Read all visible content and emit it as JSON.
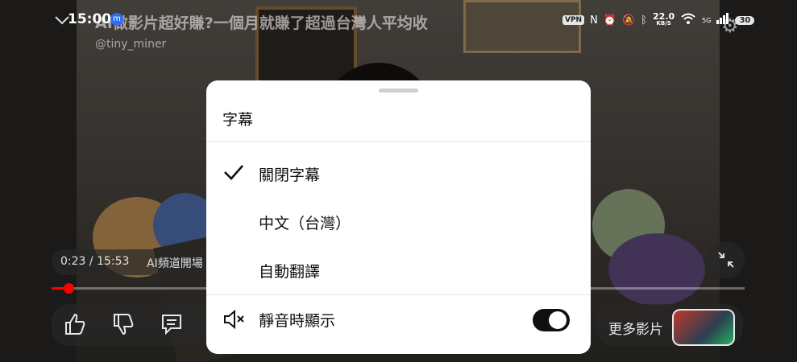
{
  "status_bar": {
    "time": "15:00",
    "vpn_label": "VPN",
    "net_speed": "22.0",
    "net_speed_unit": "KB/S",
    "signal_label": "5G",
    "battery": "30"
  },
  "video": {
    "title": "AI做影片超好賺?一個月就賺了超過台灣人平均收",
    "channel": "@tiny_miner"
  },
  "player": {
    "current_time": "0:23",
    "duration": "15:53",
    "time_separator": "/",
    "chapter": "AI頻道開場",
    "progress_fraction": 0.0145,
    "more_videos_label": "更多影片"
  },
  "captions_sheet": {
    "title": "字幕",
    "options": [
      {
        "label": "關閉字幕",
        "selected": true
      },
      {
        "label": "中文（台灣）",
        "selected": false
      },
      {
        "label": "自動翻譯",
        "selected": false
      }
    ],
    "show_when_muted": {
      "label": "靜音時顯示",
      "enabled": true
    }
  },
  "colors": {
    "accent_red": "#ff0000",
    "sheet_bg": "#ffffff",
    "toggle_on": "#0f0f0f"
  },
  "icons": [
    "collapse-icon",
    "messenger-icon",
    "settings-icon",
    "like-icon",
    "dislike-icon",
    "comment-icon",
    "exit-fullscreen-icon",
    "check-icon",
    "mute-icon"
  ]
}
